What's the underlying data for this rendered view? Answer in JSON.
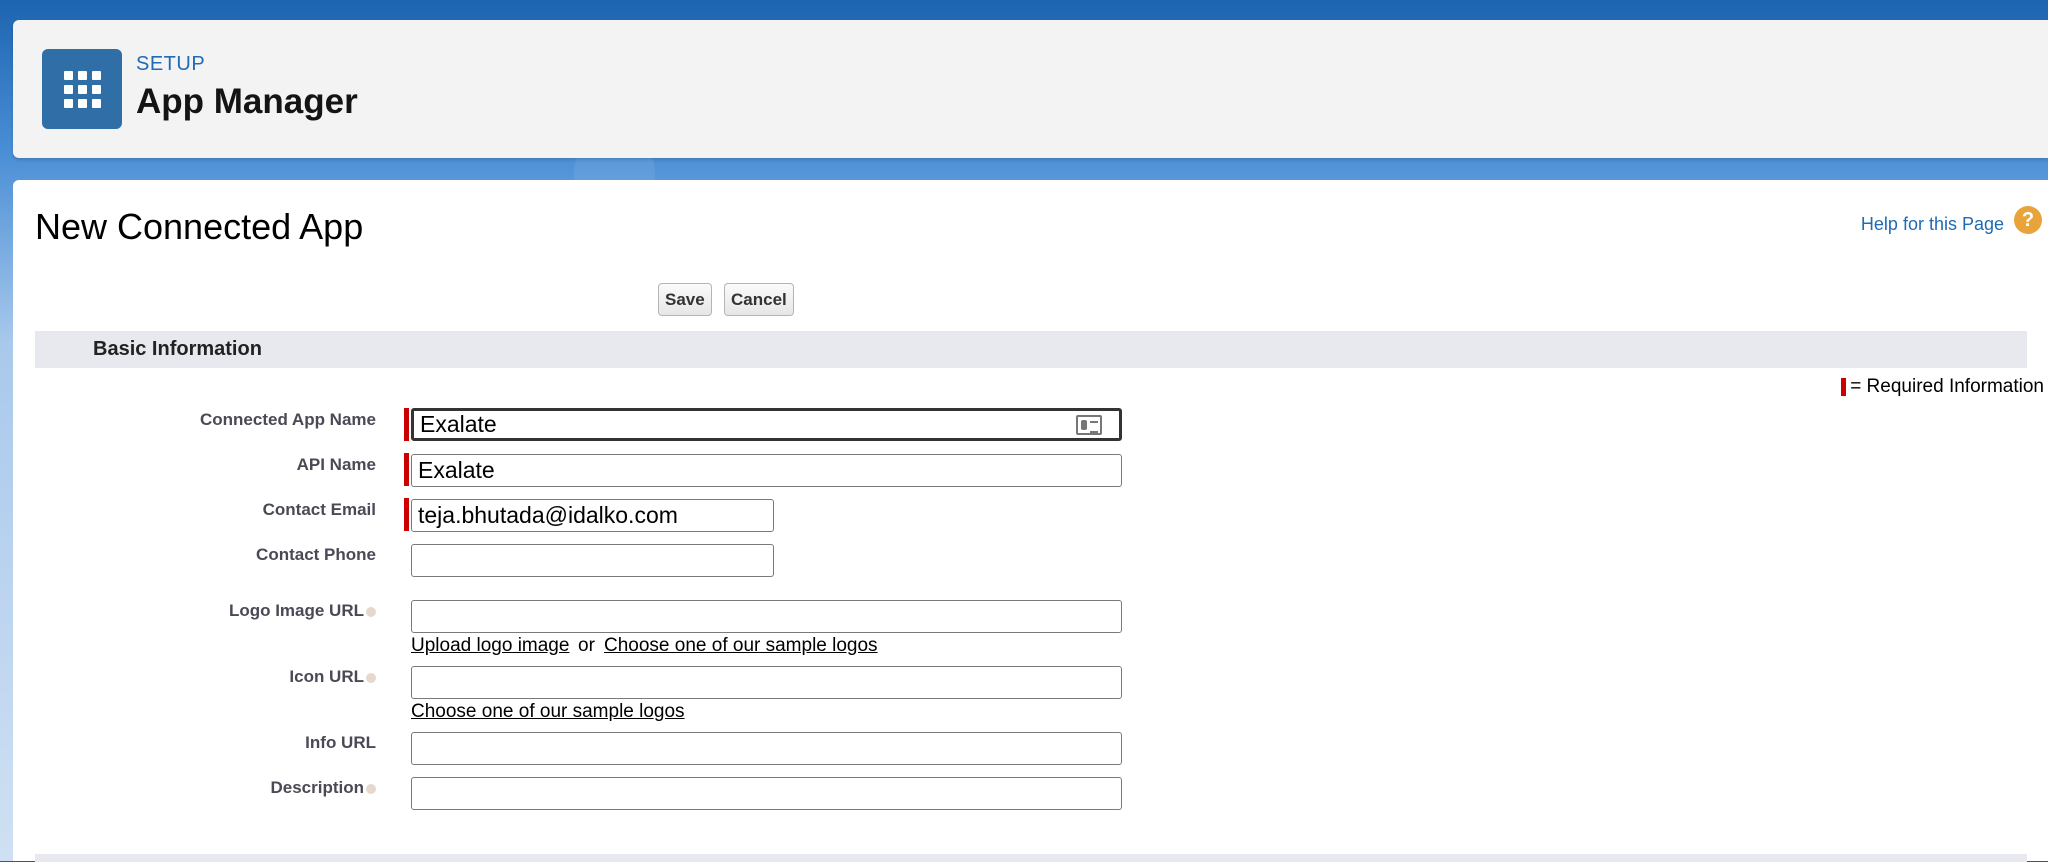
{
  "header": {
    "setup_label": "SETUP",
    "title": "App Manager",
    "icon": "app-launcher-grid-icon"
  },
  "page": {
    "title": "New Connected App",
    "help_link": "Help for this Page",
    "help_icon": "?"
  },
  "toolbar": {
    "save_label": "Save",
    "cancel_label": "Cancel"
  },
  "section": {
    "title": "Basic Information",
    "required_legend": "= Required Information"
  },
  "fields": {
    "connected_app_name": {
      "label": "Connected App Name",
      "value": "Exalate"
    },
    "api_name": {
      "label": "API Name",
      "value": "Exalate"
    },
    "contact_email": {
      "label": "Contact Email",
      "value": "teja.bhutada@idalko.com"
    },
    "contact_phone": {
      "label": "Contact Phone",
      "value": ""
    },
    "logo_image_url": {
      "label": "Logo Image URL",
      "value": "",
      "upload_link": "Upload logo image",
      "or_text": "or",
      "sample_link": "Choose one of our sample logos"
    },
    "icon_url": {
      "label": "Icon URL",
      "value": "",
      "sample_link": "Choose one of our sample logos"
    },
    "info_url": {
      "label": "Info URL",
      "value": ""
    },
    "description": {
      "label": "Description",
      "value": ""
    }
  },
  "colors": {
    "brand_blue": "#1f6bb5",
    "required_red": "#cc0000",
    "help_orange": "#e8a43a"
  }
}
